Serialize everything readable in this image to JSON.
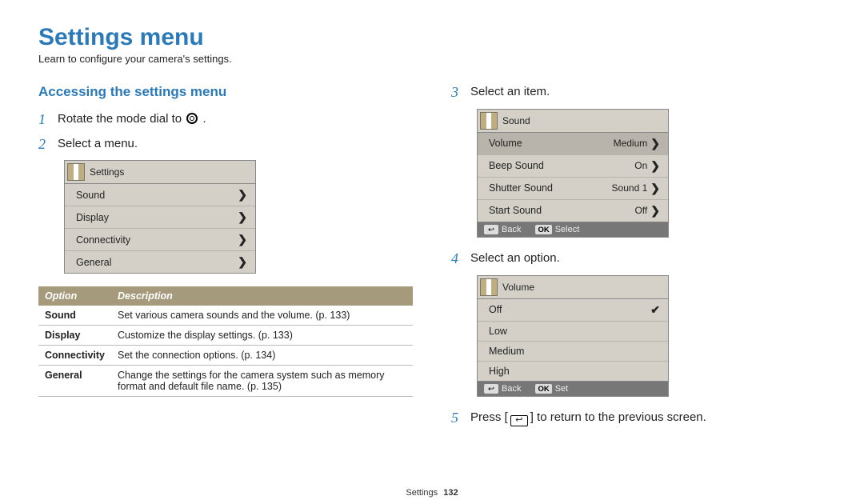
{
  "heading": "Settings menu",
  "subtitle": "Learn to configure your camera's settings.",
  "section_heading": "Accessing the settings menu",
  "steps": {
    "s1_pre": "Rotate the mode dial to ",
    "s1_post": ".",
    "s2": "Select a menu.",
    "s3": "Select an item.",
    "s4": "Select an option.",
    "s5_pre": "Press [",
    "s5_post": "] to return to the previous screen."
  },
  "panel1": {
    "title": "Settings",
    "rows": [
      {
        "label": "Sound"
      },
      {
        "label": "Display"
      },
      {
        "label": "Connectivity"
      },
      {
        "label": "General"
      }
    ]
  },
  "opts_table": {
    "h1": "Option",
    "h2": "Description",
    "rows": [
      {
        "opt": "Sound",
        "desc": "Set various camera sounds and the volume. (p. 133)"
      },
      {
        "opt": "Display",
        "desc": "Customize the display settings. (p. 133)"
      },
      {
        "opt": "Connectivity",
        "desc": "Set the connection options. (p. 134)"
      },
      {
        "opt": "General",
        "desc": "Change the settings for the camera system such as memory format and default file name. (p. 135)"
      }
    ]
  },
  "panel2": {
    "title": "Sound",
    "rows": [
      {
        "label": "Volume",
        "value": "Medium",
        "hl": true
      },
      {
        "label": "Beep Sound",
        "value": "On"
      },
      {
        "label": "Shutter Sound",
        "value": "Sound 1"
      },
      {
        "label": "Start Sound",
        "value": "Off"
      }
    ],
    "footer": {
      "back": "Back",
      "ok": "OK",
      "action": "Select"
    }
  },
  "panel3": {
    "title": "Volume",
    "rows": [
      {
        "label": "Off",
        "check": true
      },
      {
        "label": "Low"
      },
      {
        "label": "Medium"
      },
      {
        "label": "High"
      }
    ],
    "footer": {
      "back": "Back",
      "ok": "OK",
      "action": "Set"
    }
  },
  "footer": {
    "section": "Settings",
    "page": "132"
  },
  "glyphs": {
    "back": "↩"
  }
}
